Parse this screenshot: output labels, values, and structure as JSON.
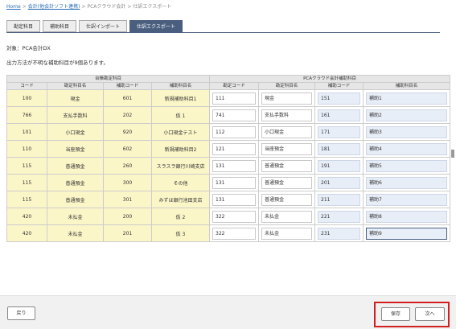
{
  "breadcrumb": {
    "items": [
      "Home",
      "会計(他会計ソフト連携)",
      "PCAクラウド会計",
      "仕訳エクスポート"
    ],
    "separator": ">"
  },
  "tabs": [
    {
      "label": "勘定科目",
      "active": false
    },
    {
      "label": "補助科目",
      "active": false
    },
    {
      "label": "仕訳インポート",
      "active": false
    },
    {
      "label": "仕訳エクスポート",
      "active": true
    }
  ],
  "target_label": "対象：PCA会計DX",
  "message": "出力方法が不明な補助科目が9個あります。",
  "table": {
    "group_left": "台帳勘定科目",
    "group_right": "PCAクラウド会計補助科目",
    "columns": [
      "コード",
      "勘定科目名",
      "補助コード",
      "補助科目名",
      "勘定コード",
      "勘定科目名",
      "補助コード",
      "補助科目名"
    ],
    "rows": [
      [
        "100",
        "現金",
        "601",
        "新規補助科目1",
        "111",
        "現金",
        "151",
        "補助1"
      ],
      [
        "766",
        "支払手数料",
        "202",
        "仮 1",
        "741",
        "支払手数料",
        "161",
        "補助2"
      ],
      [
        "101",
        "小口現金",
        "920",
        "小口現金テスト",
        "112",
        "小口現金",
        "171",
        "補助3"
      ],
      [
        "110",
        "当座預金",
        "602",
        "新規補助科目2",
        "121",
        "当座預金",
        "181",
        "補助4"
      ],
      [
        "115",
        "普通預金",
        "260",
        "スラスラ銀行川崎支店",
        "131",
        "普通預金",
        "191",
        "補助5"
      ],
      [
        "115",
        "普通預金",
        "300",
        "その他",
        "131",
        "普通預金",
        "201",
        "補助6"
      ],
      [
        "115",
        "普通預金",
        "301",
        "みずほ銀行池田支店",
        "131",
        "普通預金",
        "211",
        "補助7"
      ],
      [
        "420",
        "未払金",
        "200",
        "仮 2",
        "322",
        "未払金",
        "221",
        "補助8"
      ],
      [
        "420",
        "未払金",
        "201",
        "仮 3",
        "322",
        "未払金",
        "231",
        "補助9"
      ]
    ]
  },
  "buttons": {
    "back": "戻り",
    "save": "保存",
    "next": "次へ"
  },
  "colors": {
    "tab_active": "#4a5f7f",
    "row_yellow": "#fbf6c8",
    "highlight": "#d31f1f"
  }
}
